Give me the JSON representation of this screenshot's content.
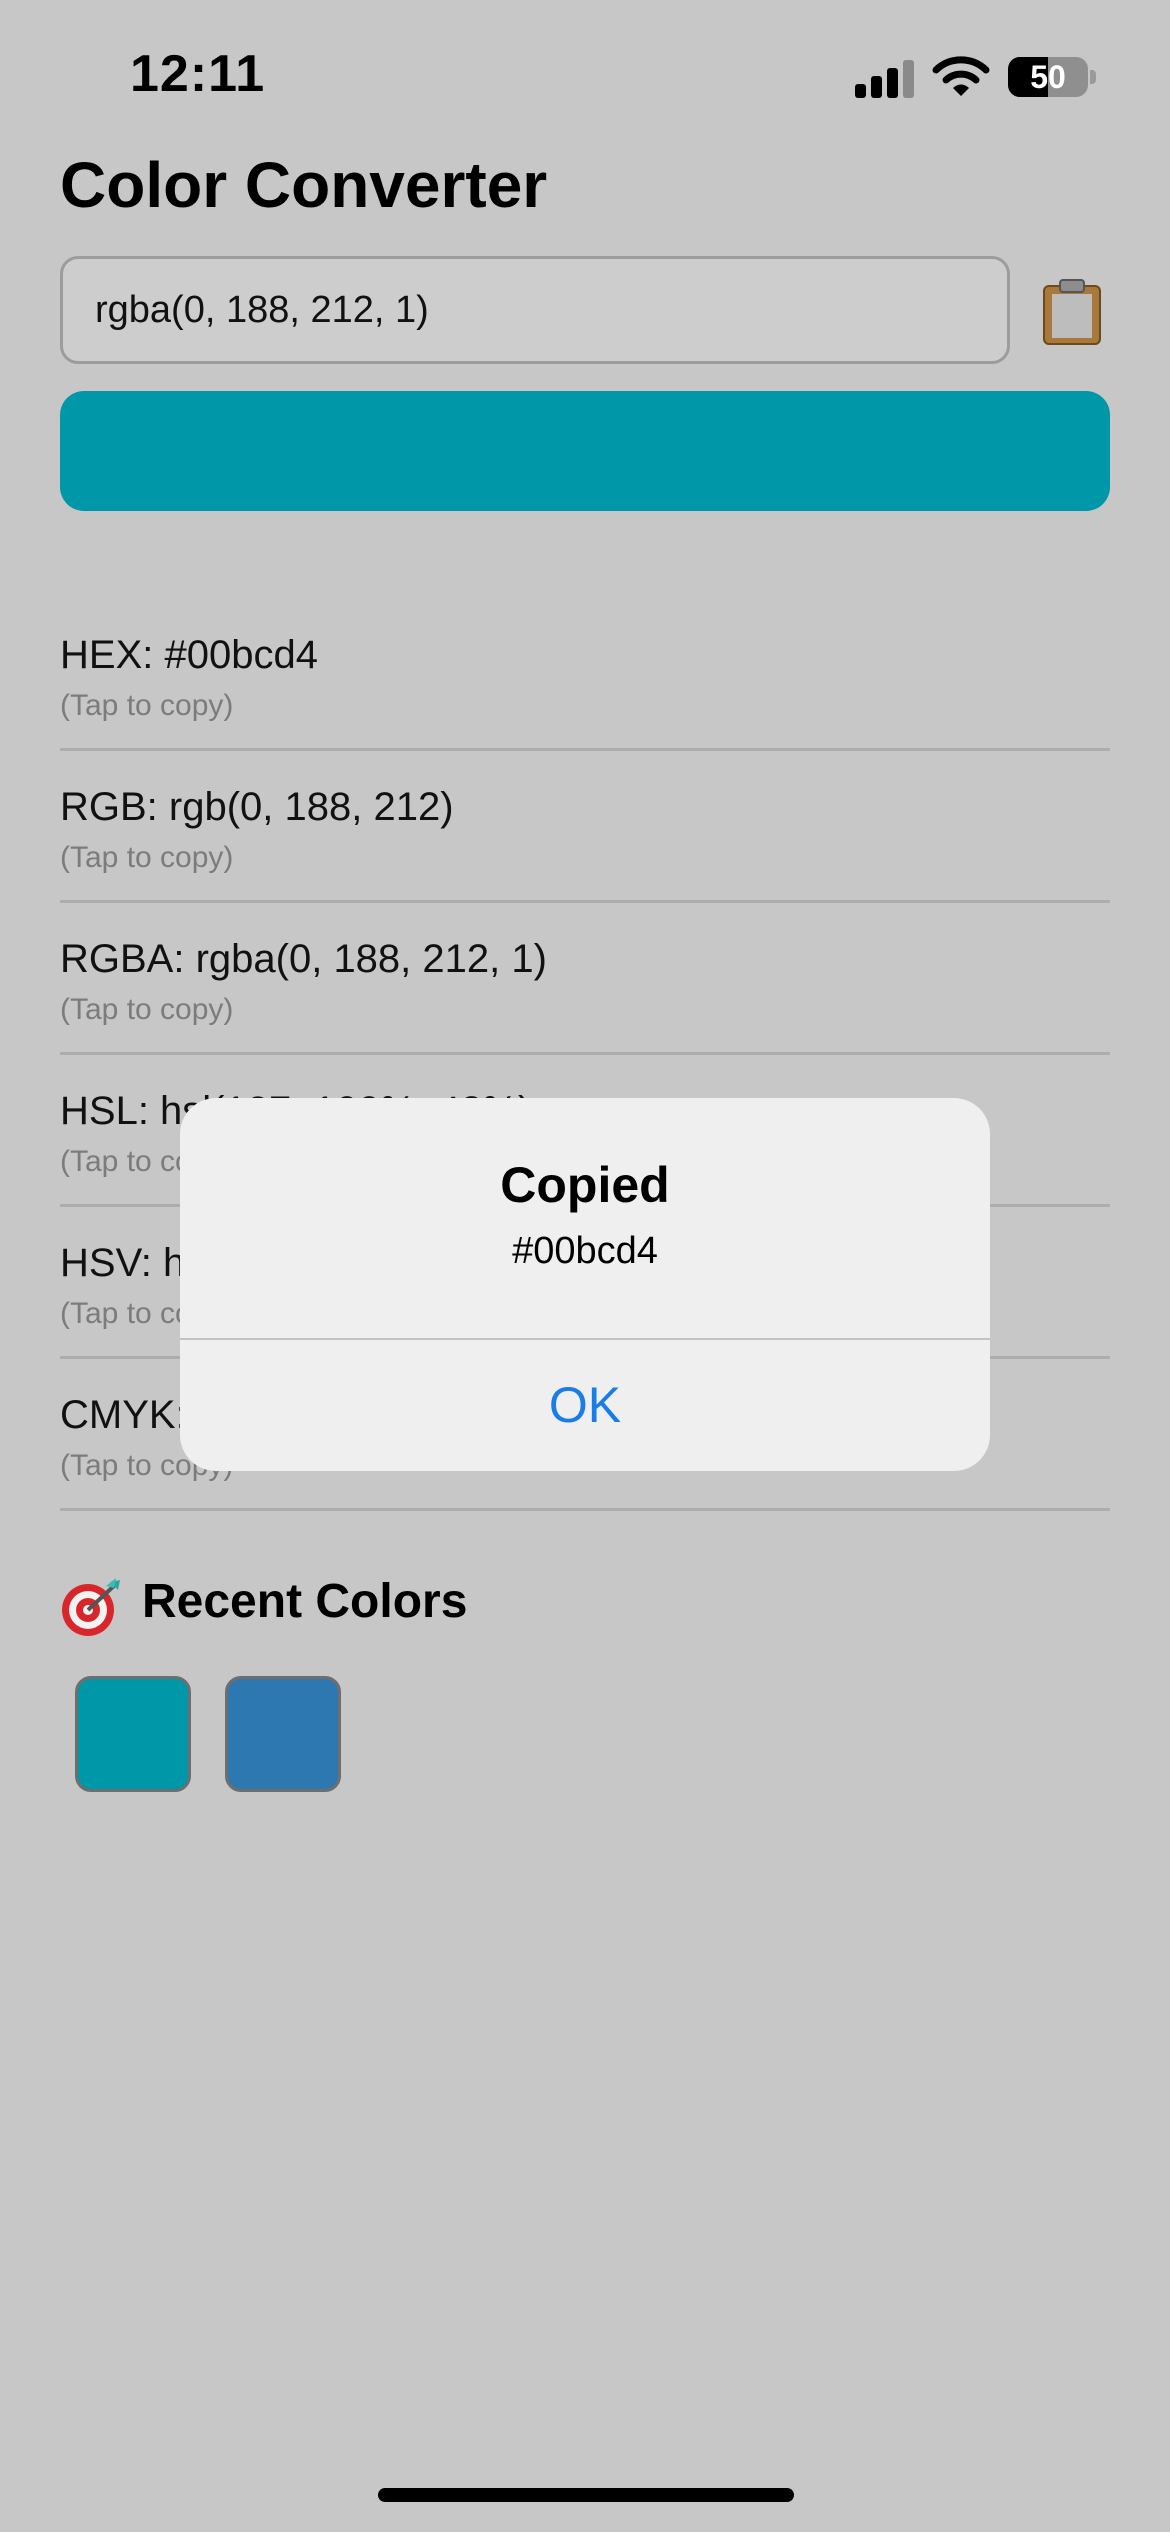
{
  "status_bar": {
    "time": "12:11",
    "battery": "50",
    "battery_level": 0.5
  },
  "page": {
    "title": "Color Converter"
  },
  "input": {
    "value": "rgba(0, 188, 212, 1)",
    "clipboard_icon": "clipboard-icon"
  },
  "preview": {
    "color": "#0097a9"
  },
  "formats": [
    {
      "label": "HEX: #00bcd4",
      "hint": "(Tap to copy)"
    },
    {
      "label": "RGB: rgb(0, 188, 212)",
      "hint": "(Tap to copy)"
    },
    {
      "label": "RGBA: rgba(0, 188, 212, 1)",
      "hint": "(Tap to copy)"
    },
    {
      "label": "HSL: hsl(187, 100%, 42%)",
      "hint": "(Tap to copy)"
    },
    {
      "label": "HSV: hsv(187, 100%, 83%)",
      "hint": "(Tap to copy)"
    },
    {
      "label": "CMYK: cmyk(100%, 11%, 0%, 17%)",
      "hint": "(Tap to copy)"
    }
  ],
  "recent": {
    "title": "Recent Colors",
    "icon": "target-icon",
    "swatches": [
      {
        "color": "#0097a9"
      },
      {
        "color": "#2e78b2"
      }
    ]
  },
  "alert": {
    "title": "Copied",
    "message": "#00bcd4",
    "ok_label": "OK"
  },
  "colors": {
    "background": "#c7c7c7",
    "accent": "#1a7ce8"
  }
}
